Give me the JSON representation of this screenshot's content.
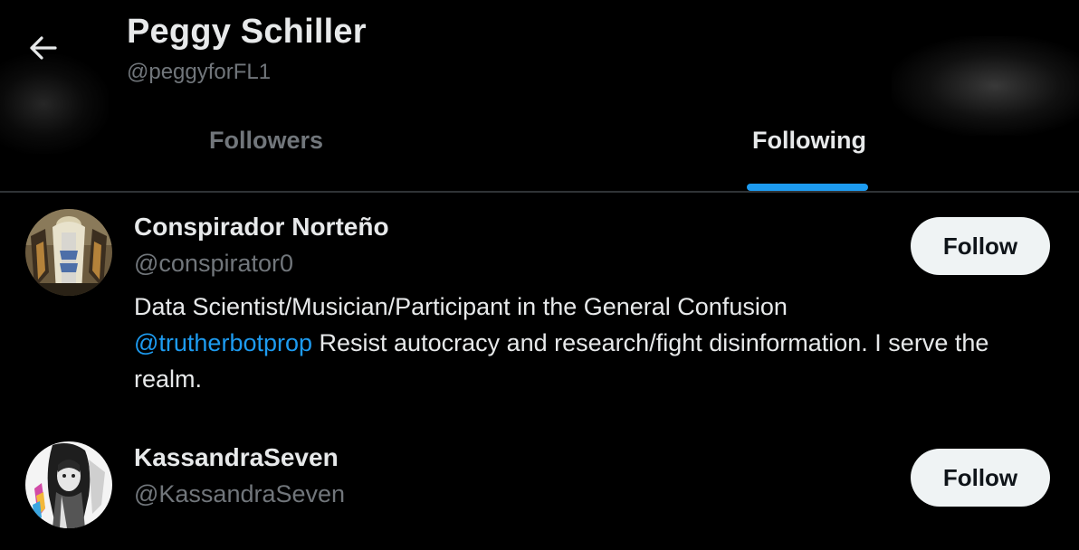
{
  "header": {
    "profile_name": "Peggy Schiller",
    "profile_handle": "@peggyforFL1",
    "back_icon": "arrow-left-icon"
  },
  "tabs": [
    {
      "label": "Followers",
      "active": false
    },
    {
      "label": "Following",
      "active": true
    }
  ],
  "colors": {
    "background": "#000000",
    "accent": "#1d9bf0",
    "primary_text": "#e7e9ea",
    "secondary_text": "#71767b",
    "follow_button_bg": "#eff3f4",
    "divider": "#2f3336"
  },
  "users": [
    {
      "name": "Conspirador Norteño",
      "handle": "@conspirator0",
      "bio_line1": "Data Scientist/Musician/Participant in the General Confusion",
      "bio_mention": "@trutherbotprop",
      "bio_rest": " Resist autocracy and research/fight disinformation. I serve the realm.",
      "follow_label": "Follow"
    },
    {
      "name": "KassandraSeven",
      "handle": "@KassandraSeven",
      "follow_label": "Follow"
    }
  ]
}
